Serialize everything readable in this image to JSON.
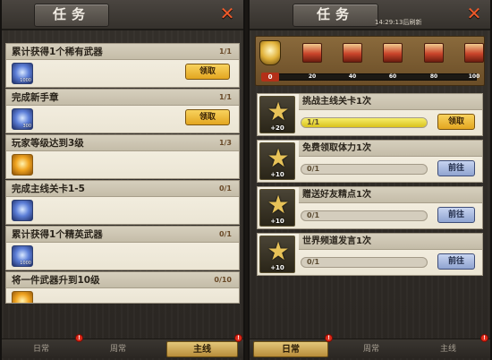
{
  "left_panel": {
    "title": "任务",
    "tasks": [
      {
        "title": "累计获得1个稀有武器",
        "progress": "1/1",
        "reward_count": "1000",
        "button": "领取",
        "icon": "weapon-crystal-icon"
      },
      {
        "title": "完成新手章",
        "progress": "1/1",
        "reward_count": "300",
        "button": "领取",
        "icon": "weapon-crystal-icon"
      },
      {
        "title": "玩家等级达到3级",
        "progress": "1/3",
        "reward_count": "",
        "button": "",
        "icon": "gold-coin-icon"
      },
      {
        "title": "完成主线关卡1-5",
        "progress": "0/1",
        "reward_count": "",
        "button": "",
        "icon": "weapon-crystal-icon"
      },
      {
        "title": "累计获得1个精英武器",
        "progress": "0/1",
        "reward_count": "1000",
        "button": "",
        "icon": "weapon-crystal-icon"
      },
      {
        "title": "将一件武器升到10级",
        "progress": "0/10",
        "reward_count": "",
        "button": "",
        "icon": "gold-coin-icon"
      }
    ],
    "tabs": [
      {
        "label": "日常",
        "active": false
      },
      {
        "label": "周常",
        "active": false
      },
      {
        "label": "主线",
        "active": true
      }
    ]
  },
  "right_panel": {
    "title": "任务",
    "timer": "14:29:13后刷新",
    "track": {
      "start_points": "0",
      "milestones": [
        "20",
        "40",
        "60",
        "80",
        "100"
      ],
      "progress": 0.0
    },
    "tasks": [
      {
        "title": "挑战主线关卡1次",
        "progress_text": "1/1",
        "progress": 1.0,
        "reward": "+20",
        "button": "领取",
        "button_type": "claim"
      },
      {
        "title": "免费领取体力1次",
        "progress_text": "0/1",
        "progress": 0.0,
        "reward": "+10",
        "button": "前往",
        "button_type": "go"
      },
      {
        "title": "赠送好友精点1次",
        "progress_text": "0/1",
        "progress": 0.0,
        "reward": "+10",
        "button": "前往",
        "button_type": "go"
      },
      {
        "title": "世界频道发言1次",
        "progress_text": "0/1",
        "progress": 0.0,
        "reward": "+10",
        "button": "前往",
        "button_type": "go"
      }
    ],
    "tabs": [
      {
        "label": "日常",
        "active": true
      },
      {
        "label": "周常",
        "active": false
      },
      {
        "label": "主线",
        "active": false
      }
    ]
  },
  "colors": {
    "accent_gold": "#e3a620",
    "close_red": "#ef5a2a",
    "badge_red": "#e02a1a",
    "go_blue": "#8fa3d0"
  }
}
